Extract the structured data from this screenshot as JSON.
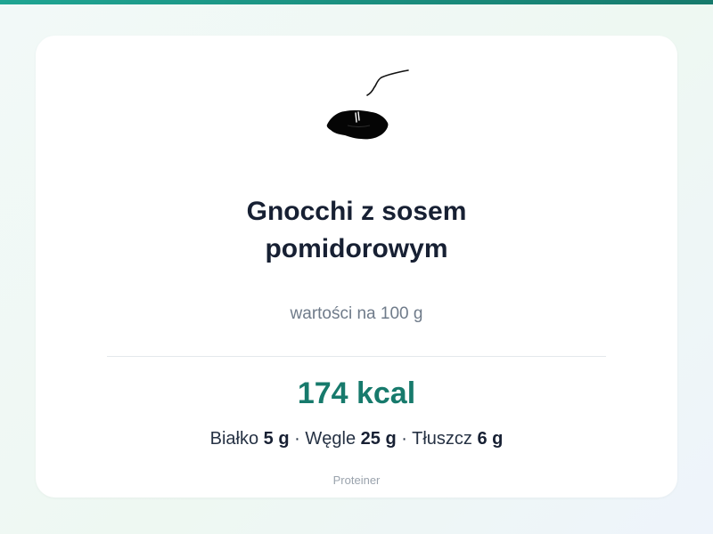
{
  "dish": {
    "icon": "gnocchi-dish-icon",
    "title_line1": "Gnocchi z sosem",
    "title_line2": "pomidorowym",
    "subtitle": "wartości na 100 g"
  },
  "nutrition": {
    "kcal": "174 kcal",
    "protein_label": "Białko",
    "protein_value": "5 g",
    "carbs_label": "Węgle",
    "carbs_value": "25 g",
    "fat_label": "Tłuszcz",
    "fat_value": "6 g",
    "separator": "·"
  },
  "brand": {
    "name": "Proteiner"
  },
  "colors": {
    "accent": "#177a6c",
    "title": "#172033",
    "muted": "#6f7b8a"
  }
}
